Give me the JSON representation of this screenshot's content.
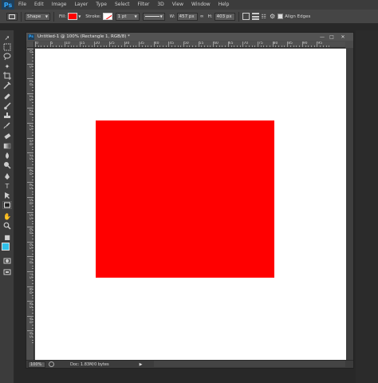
{
  "app": {
    "logo": "Ps",
    "menu": [
      "File",
      "Edit",
      "Image",
      "Layer",
      "Type",
      "Select",
      "Filter",
      "3D",
      "View",
      "Window",
      "Help"
    ]
  },
  "options": {
    "mode": "Shape",
    "fill_label": "Fill:",
    "fill_color": "#ff0000",
    "stroke_label": "Stroke:",
    "stroke_width": "1 pt",
    "w_label": "W:",
    "w_value": "457 px",
    "h_label": "H:",
    "h_value": "403 px",
    "align_edges": "Align Edges"
  },
  "document": {
    "title": "Untitled-1 @ 100% (Rectangle 1, RGB/8) *",
    "hruler_labels": [
      "0",
      "5",
      "10",
      "15",
      "20",
      "25",
      "30",
      "35",
      "40",
      "45",
      "50",
      "55",
      "60",
      "65",
      "70",
      "75",
      "80",
      "85",
      "90",
      "95"
    ],
    "vruler_labels": [
      "0",
      "5",
      "1 0",
      "1 5",
      "2 0",
      "2 5",
      "3 0",
      "3 5",
      "4 0",
      "4 5",
      "5 0",
      "5 5",
      "6 0",
      "6 5",
      "7 0",
      "7 5",
      "8 0",
      "8 5",
      "9 0",
      "9 5"
    ],
    "shape_color": "#ff0000",
    "canvas_color": "#ffffff"
  },
  "status": {
    "zoom": "100%",
    "doc_info": "Doc: 1.83M/0 bytes"
  },
  "tools": [
    "move-tool",
    "marquee-tool",
    "lasso-tool",
    "quick-select-tool",
    "crop-tool",
    "eyedropper-tool",
    "healing-brush-tool",
    "brush-tool",
    "clone-stamp-tool",
    "history-brush-tool",
    "eraser-tool",
    "gradient-tool",
    "blur-tool",
    "dodge-tool",
    "pen-tool",
    "type-tool",
    "path-selection-tool",
    "rectangle-tool",
    "hand-tool",
    "zoom-tool",
    "color-swatches",
    "quick-mask",
    "screen-mode"
  ]
}
